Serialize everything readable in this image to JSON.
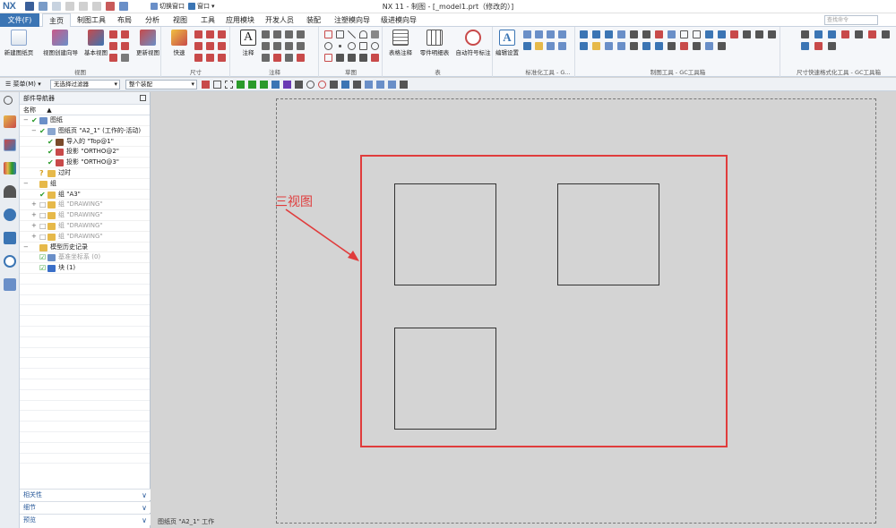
{
  "titlebar": {
    "logo": "NX",
    "title": "NX 11 - 制图 - [_model1.prt（修改的）]",
    "switch_window": "切换窗口",
    "window_menu": "窗口"
  },
  "tabs": [
    {
      "label": "文件(F)",
      "kind": "file"
    },
    {
      "label": "主页",
      "kind": "active"
    },
    {
      "label": "制图工具",
      "kind": ""
    },
    {
      "label": "布局",
      "kind": ""
    },
    {
      "label": "分析",
      "kind": ""
    },
    {
      "label": "视图",
      "kind": ""
    },
    {
      "label": "工具",
      "kind": ""
    },
    {
      "label": "应用模块",
      "kind": ""
    },
    {
      "label": "开发人员",
      "kind": ""
    },
    {
      "label": "装配",
      "kind": ""
    },
    {
      "label": "注塑模向导",
      "kind": ""
    },
    {
      "label": "级进模向导",
      "kind": ""
    }
  ],
  "search": {
    "placeholder": "查找命令"
  },
  "ribbon": {
    "new_sheet": "新建图纸页",
    "view_wizard": "视图创建向导",
    "base_view": "基本视图",
    "update_view": "更新视图",
    "group_view": "视图",
    "quick": "快速",
    "group_dimension": "尺寸",
    "note": "注释",
    "group_annotation": "注释",
    "group_sketch": "草图",
    "table_note": "表格注释",
    "parts_list": "零件明细表",
    "auto_balloon": "自动符号标注",
    "group_table": "表",
    "edit_settings": "编辑设置",
    "group_std_tools": "标准化工具 - G...",
    "group_drafting_tools": "制图工具 - GC工具箱",
    "group_dim_tools": "尺寸快速格式化工具 - GC工具箱"
  },
  "selbar": {
    "menu": "菜单(M)",
    "filter": "无选择过滤器",
    "scope": "整个装配"
  },
  "navigator": {
    "title": "部件导航器",
    "col_name": "名称",
    "rows": [
      {
        "indent": 0,
        "exp": "−",
        "check": "✔",
        "icon": "#6a8fc8",
        "text": "图纸",
        "dim": false
      },
      {
        "indent": 1,
        "exp": "−",
        "check": "✔",
        "icon": "#8aa6cf",
        "text": "图纸页 \"A2_1\" (工作的-活动)",
        "dim": false
      },
      {
        "indent": 2,
        "exp": "",
        "check": "✔",
        "icon": "#7a4a2a",
        "text": "导入的 \"Top@1\"",
        "dim": false
      },
      {
        "indent": 2,
        "exp": "",
        "check": "✔",
        "icon": "#c84a4a",
        "text": "投影 \"ORTHO@2\"",
        "dim": false
      },
      {
        "indent": 2,
        "exp": "",
        "check": "✔",
        "icon": "#c84a4a",
        "text": "投影 \"ORTHO@3\"",
        "dim": false
      },
      {
        "indent": 1,
        "exp": "",
        "check": "?",
        "icon": "#e6b94a",
        "text": "过时",
        "dim": false
      },
      {
        "indent": 0,
        "exp": "−",
        "check": "",
        "icon": "#e6b94a",
        "text": "组",
        "dim": false
      },
      {
        "indent": 1,
        "exp": "",
        "check": "✔",
        "icon": "#e6b94a",
        "text": "组 \"A3\"",
        "dim": false
      },
      {
        "indent": 1,
        "exp": "+",
        "check": "□",
        "icon": "#e6b94a",
        "text": "组 \"DRAWING\"",
        "dim": true
      },
      {
        "indent": 1,
        "exp": "+",
        "check": "□",
        "icon": "#e6b94a",
        "text": "组 \"DRAWING\"",
        "dim": true
      },
      {
        "indent": 1,
        "exp": "+",
        "check": "□",
        "icon": "#e6b94a",
        "text": "组 \"DRAWING\"",
        "dim": true
      },
      {
        "indent": 1,
        "exp": "+",
        "check": "□",
        "icon": "#e6b94a",
        "text": "组 \"DRAWING\"",
        "dim": true
      },
      {
        "indent": 0,
        "exp": "−",
        "check": "",
        "icon": "#e6b94a",
        "text": "模型历史记录",
        "dim": false
      },
      {
        "indent": 1,
        "exp": "",
        "check": "☑",
        "icon": "#6a8fc8",
        "text": "基准坐标系 (0)",
        "dim": true
      },
      {
        "indent": 1,
        "exp": "",
        "check": "☑",
        "icon": "#3a6fc8",
        "text": "块 (1)",
        "dim": false
      }
    ],
    "sections": [
      "相关性",
      "细节",
      "预览"
    ]
  },
  "graphics": {
    "callout": "三视图",
    "sheet_status": "图纸页 \"A2_1\" 工作"
  },
  "colors": {
    "accent": "#3b75b4",
    "frame_red": "#e03c3c",
    "background": "#d4d4d4"
  }
}
